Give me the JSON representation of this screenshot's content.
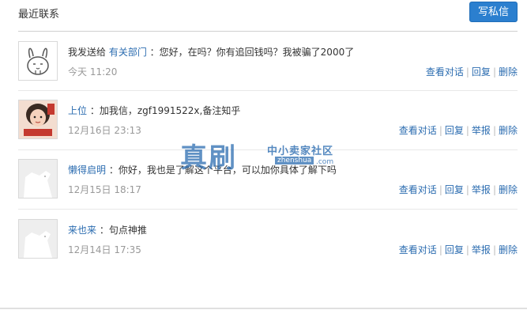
{
  "header": {
    "title": "最近联系",
    "compose_label": "写私信"
  },
  "messages": [
    {
      "prefix": "我发送给 ",
      "name": "有关部门",
      "sep": " ：",
      "text": "您好，在吗？你有追回钱吗？我被骗了2000了",
      "time": "今天 11:20",
      "actions": [
        "查看对话",
        "回复",
        "删除"
      ]
    },
    {
      "prefix": "",
      "name": "上位",
      "sep": " ：",
      "text": "加我信，zgf1991522x,备注知乎",
      "time": "12月16日 23:13",
      "actions": [
        "查看对话",
        "回复",
        "举报",
        "删除"
      ]
    },
    {
      "prefix": "",
      "name": "懒得启明",
      "sep": " ：",
      "text": "你好，我也是了解这个平台，可以加你具体了解下吗",
      "time": "12月15日 18:17",
      "actions": [
        "查看对话",
        "回复",
        "举报",
        "删除"
      ]
    },
    {
      "prefix": "",
      "name": "来也来",
      "sep": " ：",
      "text": "句点神推",
      "time": "12月14日 17:35",
      "actions": [
        "查看对话",
        "回复",
        "举报",
        "删除"
      ]
    }
  ],
  "watermark": {
    "big": "真刷",
    "small": "中小卖家社区",
    "domain": "zhenshua",
    "com": ".com"
  },
  "colors": {
    "accent": "#2b7fcf",
    "link": "#2b6cb0",
    "muted": "#999999"
  }
}
